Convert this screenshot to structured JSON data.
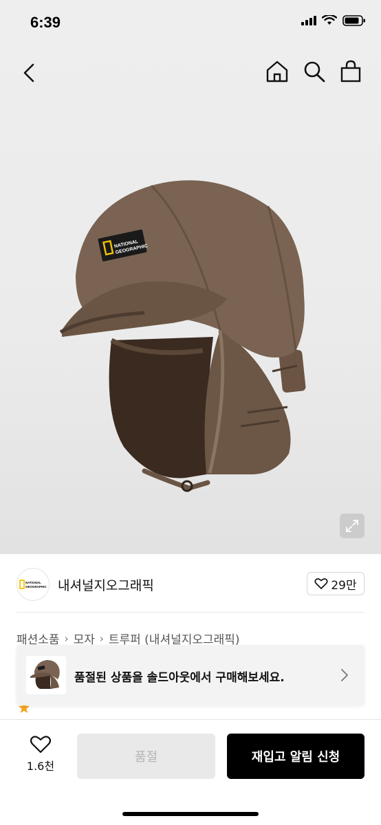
{
  "status_bar": {
    "time": "6:39"
  },
  "icons": {
    "back": "chevron-left-icon",
    "home": "home-icon",
    "search": "search-icon",
    "bag": "shopping-bag-icon",
    "expand": "expand-icon",
    "heart": "heart-icon",
    "chevron": "chevron-right-icon"
  },
  "brand": {
    "name": "내셔널지오그래픽",
    "logo_text": "NATIONAL GEOGRAPHIC",
    "likes": "29만"
  },
  "breadcrumb": [
    "패션소품",
    "모자",
    "트루퍼 (내셔널지오그래픽)"
  ],
  "banner": {
    "text": "품절된 상품을 솔드아웃에서 구매해보세요."
  },
  "hat_patch": "NATIONAL GEOGRAPHIC",
  "bottom": {
    "wish_count": "1.6천",
    "soldout_label": "품절",
    "restock_label": "재입고 알림 신청"
  },
  "colors": {
    "accent": "#000000",
    "brand_yellow": "#f5c400",
    "disabled_bg": "#e9e9e9"
  }
}
